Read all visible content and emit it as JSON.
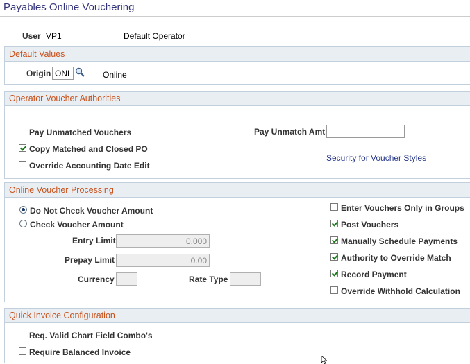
{
  "page": {
    "title": "Payables Online Vouchering"
  },
  "user": {
    "label": "User",
    "id": "VP1",
    "name": "Default Operator"
  },
  "default_values": {
    "header": "Default Values",
    "origin_label": "Origin",
    "origin_value": "ONL",
    "origin_description": "Online"
  },
  "authorities": {
    "header": "Operator Voucher Authorities",
    "pay_unmatched": {
      "label": "Pay Unmatched Vouchers",
      "checked": false
    },
    "copy_matched": {
      "label": "Copy Matched and Closed PO",
      "checked": true
    },
    "override_acct_date": {
      "label": "Override Accounting Date Edit",
      "checked": false
    },
    "pay_unmatch_amt_label": "Pay Unmatch Amt",
    "pay_unmatch_amt_value": "",
    "security_link": "Security for Voucher Styles"
  },
  "processing": {
    "header": "Online Voucher Processing",
    "do_not_check": {
      "label": "Do Not Check Voucher Amount",
      "selected": true
    },
    "check_amount": {
      "label": "Check Voucher Amount",
      "selected": false
    },
    "entry_limit_label": "Entry Limit",
    "entry_limit_value": "0.000",
    "prepay_limit_label": "Prepay Limit",
    "prepay_limit_value": "0.00",
    "currency_label": "Currency",
    "currency_value": "",
    "rate_type_label": "Rate Type",
    "rate_type_value": "",
    "enter_in_groups": {
      "label": "Enter Vouchers Only in Groups",
      "checked": false
    },
    "post_vouchers": {
      "label": "Post Vouchers",
      "checked": true
    },
    "manually_schedule": {
      "label": "Manually Schedule Payments",
      "checked": true
    },
    "override_match": {
      "label": "Authority to Override Match",
      "checked": true
    },
    "record_payment": {
      "label": "Record Payment",
      "checked": true
    },
    "override_withhold": {
      "label": "Override Withhold Calculation",
      "checked": false
    }
  },
  "quick_invoice": {
    "header": "Quick Invoice Configuration",
    "req_valid_chartfield": {
      "label": "Req. Valid Chart Field Combo's",
      "checked": false
    },
    "require_balanced": {
      "label": "Require Balanced Invoice",
      "checked": false
    }
  },
  "icons": {
    "lookup": "magnifier-icon",
    "cursor": "mouse-pointer-icon"
  }
}
